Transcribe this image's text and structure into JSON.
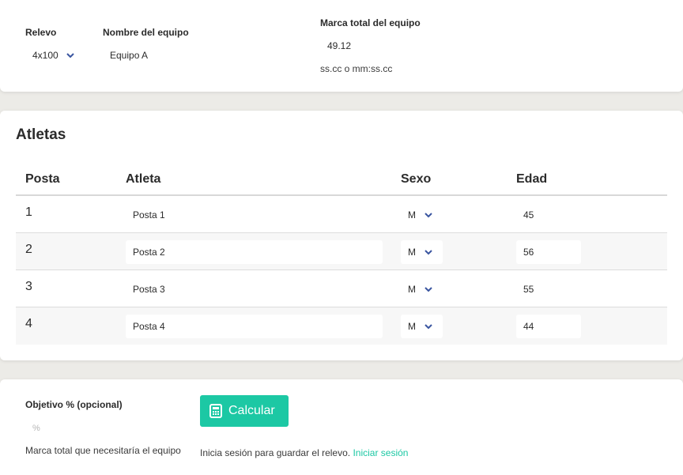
{
  "team": {
    "relay_label": "Relevo",
    "relay_value": "4x100",
    "team_name_label": "Nombre del equipo",
    "team_name_value": "Equipo A",
    "total_time_label": "Marca total del equipo",
    "total_time_value": "49.12",
    "total_time_hint": "ss.cc o mm:ss.cc"
  },
  "athletes": {
    "title": "Atletas",
    "columns": [
      "Posta",
      "Atleta",
      "Sexo",
      "Edad"
    ],
    "rows": [
      {
        "posta": "1",
        "name": "Posta 1",
        "sex": "M",
        "age": "45"
      },
      {
        "posta": "2",
        "name": "Posta 2",
        "sex": "M",
        "age": "56"
      },
      {
        "posta": "3",
        "name": "Posta 3",
        "sex": "M",
        "age": "55"
      },
      {
        "posta": "4",
        "name": "Posta 4",
        "sex": "M",
        "age": "44"
      }
    ]
  },
  "goal": {
    "label": "Objetivo % (opcional)",
    "placeholder": "%",
    "hint": "Marca total que necesitaría el equipo"
  },
  "actions": {
    "calculate_label": "Calcular",
    "login_prompt": "Inicia sesión para guardar el relevo.",
    "login_link": "Iniciar sesión"
  },
  "colors": {
    "accent": "#1cc8a4",
    "chevron": "#3a55a0",
    "background": "#ecebe7"
  },
  "icons": {
    "dropdown": "chevron-down-icon",
    "calculate": "calculator-icon"
  }
}
